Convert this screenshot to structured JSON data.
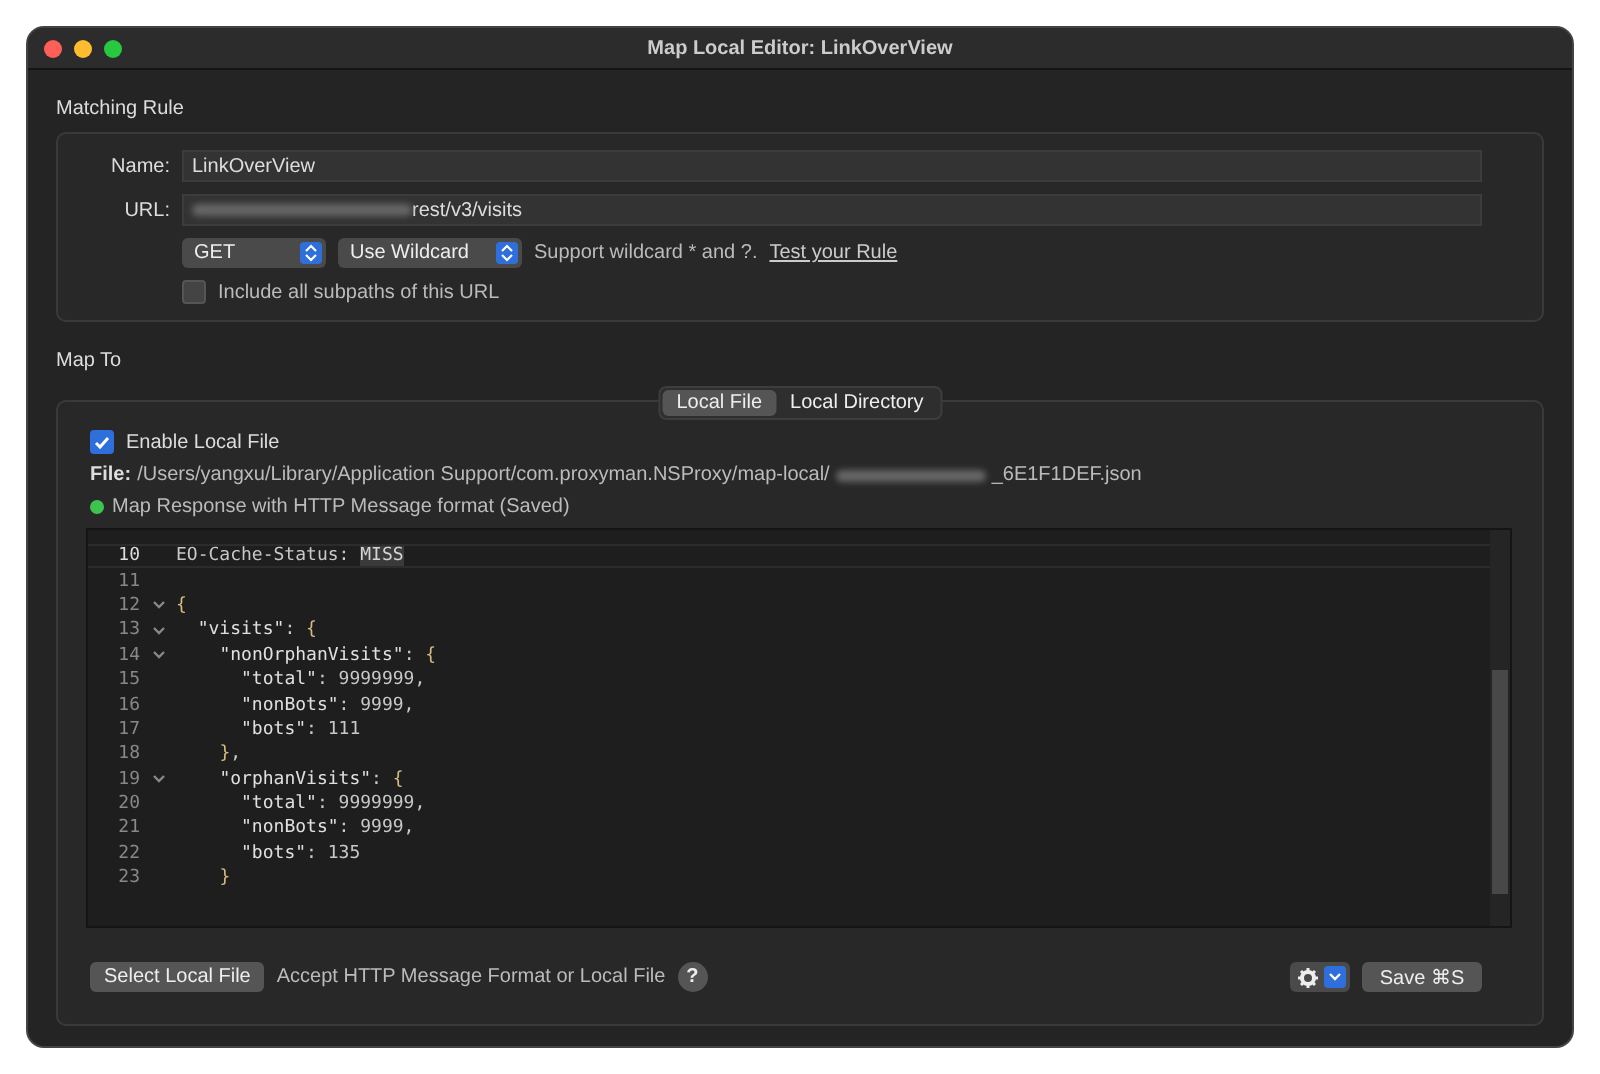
{
  "window": {
    "title": "Map Local Editor: LinkOverView"
  },
  "matching_rule": {
    "heading": "Matching Rule",
    "name_label": "Name:",
    "name_value": "LinkOverView",
    "url_label": "URL:",
    "url_value": "rest/v3/visits",
    "method": "GET",
    "match_mode": "Use Wildcard",
    "hint": "Support wildcard * and ?.",
    "test_link": "Test your Rule",
    "subpaths": {
      "label": "Include all subpaths of this URL",
      "checked": false
    }
  },
  "map_to": {
    "heading": "Map To",
    "tabs": [
      {
        "label": "Local File",
        "selected": true
      },
      {
        "label": "Local Directory",
        "selected": false
      }
    ],
    "enable": {
      "label": "Enable Local File",
      "checked": true
    },
    "file_label": "File:",
    "file_path": "/Users/yangxu/Library/Application Support/com.proxyman.NSProxy/map-local/",
    "file_suffix": "_6E1F1DEF.json",
    "status": {
      "text": "Map Response with HTTP Message format (Saved)",
      "color": "#3fc34f"
    },
    "code_lines": [
      {
        "num": "10",
        "text": "EO-Cache-Status: ",
        "highlight": "MISS",
        "fold": false,
        "current": true
      },
      {
        "num": "11",
        "fold": false,
        "current": false
      },
      {
        "num": "12",
        "text": "{",
        "fold": true,
        "current": false
      },
      {
        "num": "13",
        "text": "  \"visits\": {",
        "fold": true,
        "current": false
      },
      {
        "num": "14",
        "text": "    \"nonOrphanVisits\": {",
        "fold": true,
        "current": false
      },
      {
        "num": "15",
        "text": "      \"total\": 9999999,",
        "fold": false,
        "current": false
      },
      {
        "num": "16",
        "text": "      \"nonBots\": 9999,",
        "fold": false,
        "current": false
      },
      {
        "num": "17",
        "text": "      \"bots\": 111",
        "fold": false,
        "current": false
      },
      {
        "num": "18",
        "text": "    },",
        "fold": false,
        "current": false
      },
      {
        "num": "19",
        "text": "    \"orphanVisits\": {",
        "fold": true,
        "current": false
      },
      {
        "num": "20",
        "text": "      \"total\": 9999999,",
        "fold": false,
        "current": false
      },
      {
        "num": "21",
        "text": "      \"nonBots\": 9999,",
        "fold": false,
        "current": false
      },
      {
        "num": "22",
        "text": "      \"bots\": 135",
        "fold": false,
        "current": false
      },
      {
        "num": "23",
        "text": "    }",
        "fold": false,
        "current": false
      }
    ],
    "select_button": "Select Local File",
    "footer_hint": "Accept HTTP Message Format or Local File",
    "help": "?",
    "save_button": "Save ⌘S"
  }
}
